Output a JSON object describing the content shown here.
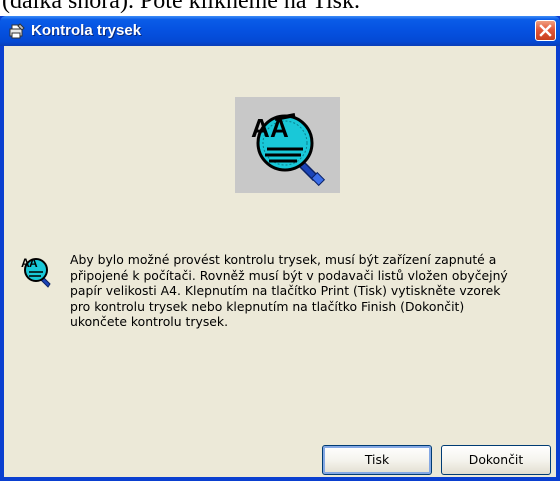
{
  "background_text": "(dalka shora). Pote klikneme na Tisk.",
  "window": {
    "title": "Kontrola trysek",
    "title_icon": "printer-wrench-icon",
    "close_icon": "close-icon"
  },
  "content": {
    "large_icon": "nozzle-check-magnifier-icon",
    "small_icon": "nozzle-check-magnifier-icon",
    "message": "Aby bylo možné provést kontrolu trysek, musí být zařízení zapnuté a\npřipojené k počítači. Rovněž musí být v podavači listů vložen obyčejný\npapír velikosti A4. Klepnutím na tlačítko Print (Tisk) vytiskněte vzorek\npro kontrolu trysek nebo klepnutím na tlačítko Finish (Dokončit)\nukončete kontrolu trysek."
  },
  "buttons": {
    "print_label": "Tisk",
    "finish_label": "Dokončit"
  },
  "colors": {
    "titlebar": "#0551e0",
    "dialog_bg": "#ece9d8",
    "close_button": "#e2583a",
    "icon_cyan": "#19c8d8"
  }
}
